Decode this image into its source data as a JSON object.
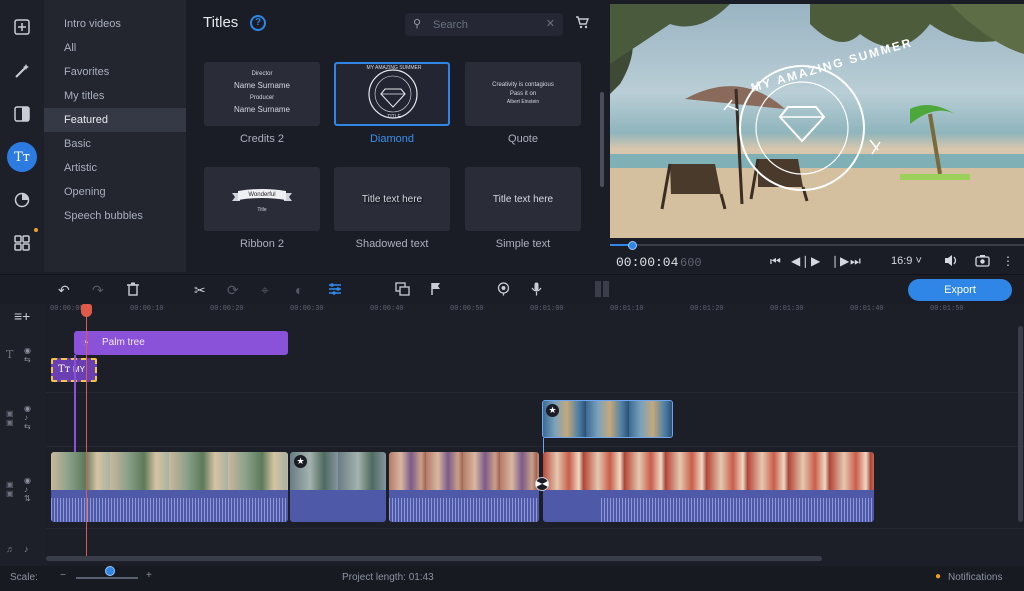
{
  "categories": [
    "Intro videos",
    "All",
    "Favorites",
    "My titles",
    "Featured",
    "Basic",
    "Artistic",
    "Opening",
    "Speech bubbles"
  ],
  "selected_category": "Featured",
  "titles_panel": {
    "heading": "Titles",
    "search_placeholder": "Search",
    "tiles": [
      {
        "label": "Credits 2",
        "mini": [
          "Director",
          "Name Surname",
          "Producer",
          "Name Surname"
        ]
      },
      {
        "label": "Diamond",
        "mini": [
          "MY AMAZING SUMMER",
          "TITLE"
        ],
        "selected": true
      },
      {
        "label": "Quote",
        "mini": [
          "Creativity is contagious",
          "Pass it on",
          "Albert Einstein"
        ]
      },
      {
        "label": "Ribbon 2",
        "mini": [
          "Wonderful",
          "Title"
        ]
      },
      {
        "label": "Shadowed text",
        "mini": [
          "Title text here"
        ]
      },
      {
        "label": "Simple text",
        "mini": [
          "Title text here"
        ]
      }
    ]
  },
  "preview": {
    "overlay_text": "MY AMAZING SUMMER",
    "timecode": "00:00:04",
    "frames": "600",
    "aspect_ratio": "16:9"
  },
  "toolbar": {
    "export_label": "Export"
  },
  "timeline": {
    "ruler_ticks": [
      "00:00:00",
      "00:00:10",
      "00:00:20",
      "00:00:30",
      "00:00:40",
      "00:00:50",
      "00:01:00",
      "00:01:10",
      "00:01:20",
      "00:01:30",
      "00:01:40",
      "00:01:50"
    ],
    "title_clip_label": "Palm tree",
    "title_clip_small": "MY"
  },
  "status": {
    "scale_label": "Scale:",
    "project_length_label": "Project length:",
    "project_length_value": "01:43",
    "notifications_label": "Notifications"
  },
  "colors": {
    "accent": "#2f86e6",
    "title_clip": "#8a52d8",
    "playhead": "#e05a4a",
    "audio": "#4e5aa8"
  }
}
